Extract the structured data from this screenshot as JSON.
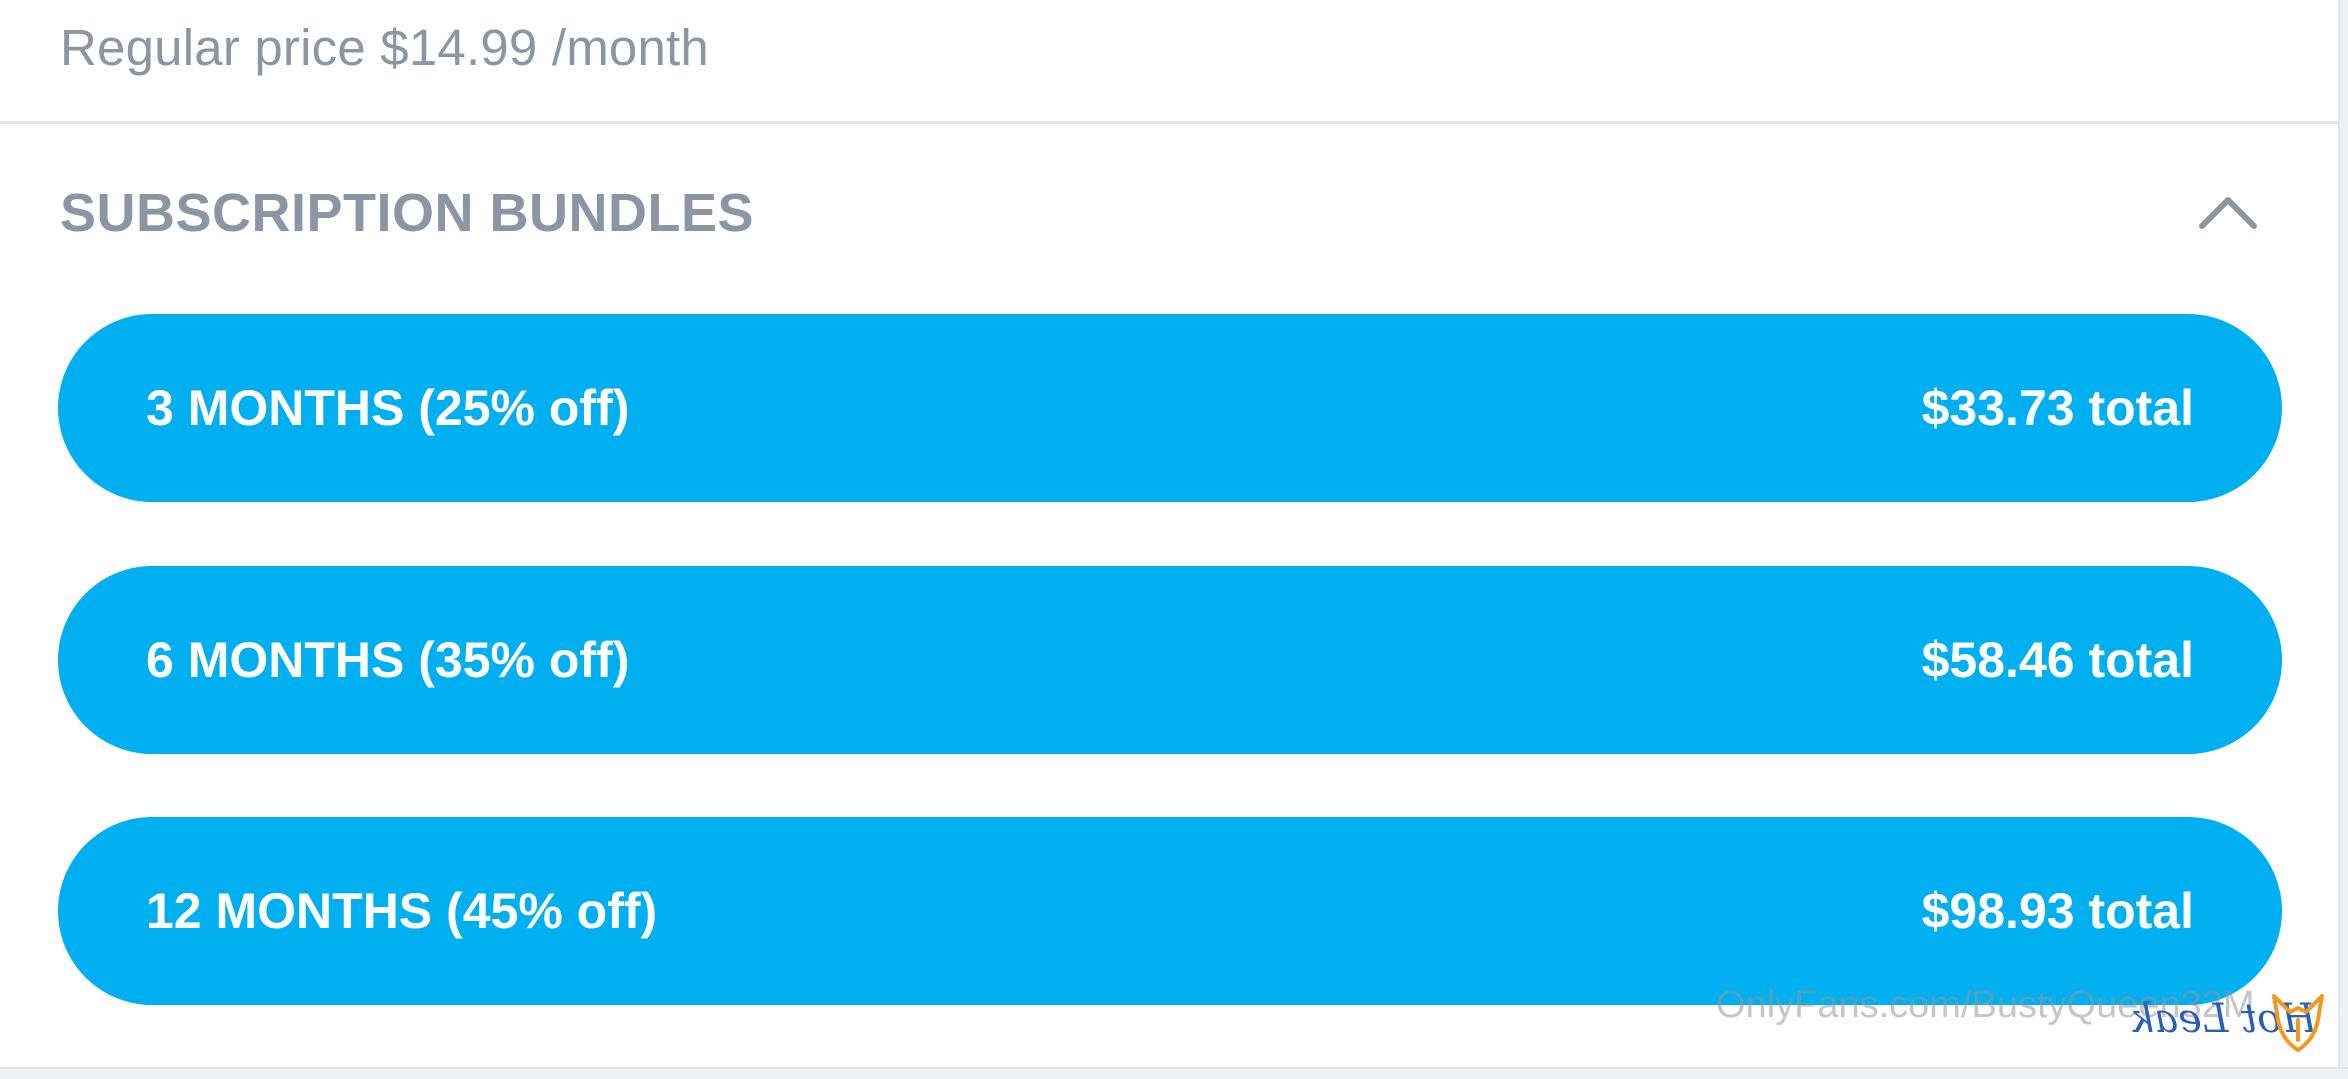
{
  "pricing": {
    "regular_price": "Regular price $14.99 /month"
  },
  "bundles_section": {
    "title": "SUBSCRIPTION BUNDLES",
    "collapse_icon": "chevron-up-icon",
    "items": [
      {
        "label": "3 MONTHS (25% off)",
        "total": "$33.73 total"
      },
      {
        "label": "6 MONTHS (35% off)",
        "total": "$58.46 total"
      },
      {
        "label": "12 MONTHS (45% off)",
        "total": "$98.93 total"
      }
    ]
  },
  "watermark": {
    "text": "OnlyFans.com/BustyQueen32M",
    "logo_text": "Hot Leak",
    "logo_icon": "fox-logo-icon"
  },
  "colors": {
    "accent": "#00aff0",
    "muted_text": "#8a96a3",
    "divider": "#e3e6e9"
  }
}
